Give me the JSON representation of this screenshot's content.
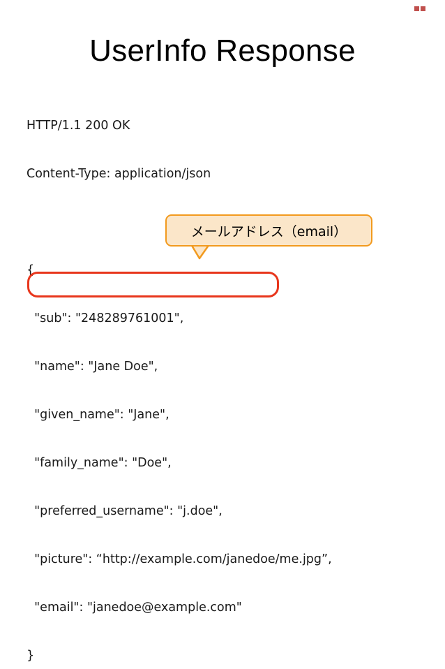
{
  "title": "UserInfo Response",
  "response": {
    "status_line": "HTTP/1.1 200 OK",
    "content_type": "Content-Type: application/json",
    "lines": [
      "{",
      "  \"sub\": \"248289761001\",",
      "  \"name\": \"Jane Doe\",",
      "  \"given_name\": \"Jane\",",
      "  \"family_name\": \"Doe\",",
      "  \"preferred_username\": \"j.doe\",",
      "  \"picture\": “http://example.com/janedoe/me.jpg”,",
      "  \"email\": \"janedoe@example.com\"",
      "}"
    ]
  },
  "callout": {
    "label": "メールアドレス（email）"
  },
  "colors": {
    "callout_fill": "#fbe6c9",
    "callout_border": "#f29a1e",
    "highlight_border": "#e8361c",
    "corner_accent": "#c0504d"
  }
}
